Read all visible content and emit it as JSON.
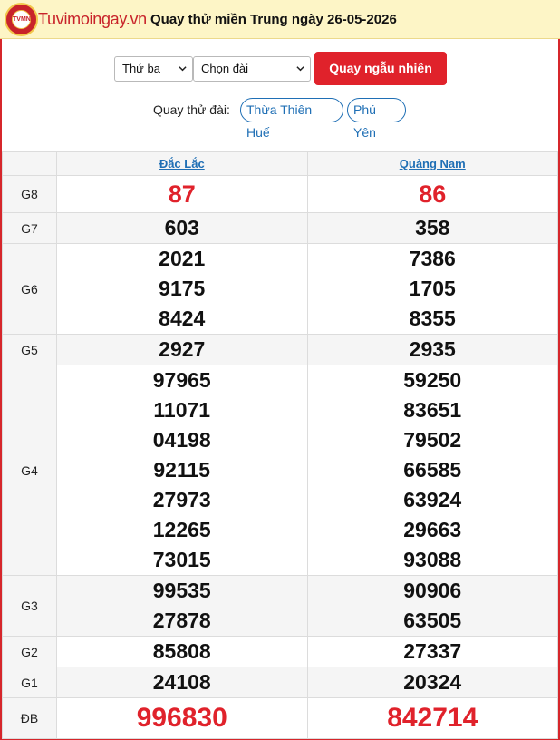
{
  "header": {
    "logo_badge": "TVMN",
    "logo_text": "Tuvimoingay.vn",
    "title": "Quay thử miền Trung ngày 26-05-2026"
  },
  "controls": {
    "day_select": "Thứ ba",
    "station_select": "Chọn đài",
    "random_button": "Quay ngẫu nhiên",
    "button_color": "#e0222b"
  },
  "stations": {
    "label": "Quay thử đài:",
    "items": [
      "Thừa Thiên Huế",
      "Phú Yên"
    ]
  },
  "table": {
    "columns": [
      "Đắc Lắc",
      "Quảng Nam"
    ],
    "rows": [
      {
        "label": "G8",
        "style": "red",
        "values": [
          [
            "87"
          ],
          [
            "86"
          ]
        ]
      },
      {
        "label": "G7",
        "style": "normal",
        "values": [
          [
            "603"
          ],
          [
            "358"
          ]
        ]
      },
      {
        "label": "G6",
        "style": "normal",
        "values": [
          [
            "2021",
            "9175",
            "8424"
          ],
          [
            "7386",
            "1705",
            "8355"
          ]
        ]
      },
      {
        "label": "G5",
        "style": "normal",
        "values": [
          [
            "2927"
          ],
          [
            "2935"
          ]
        ]
      },
      {
        "label": "G4",
        "style": "normal",
        "values": [
          [
            "97965",
            "11071",
            "04198",
            "92115",
            "27973",
            "12265",
            "73015"
          ],
          [
            "59250",
            "83651",
            "79502",
            "66585",
            "63924",
            "29663",
            "93088"
          ]
        ]
      },
      {
        "label": "G3",
        "style": "normal",
        "values": [
          [
            "99535",
            "27878"
          ],
          [
            "90906",
            "63505"
          ]
        ]
      },
      {
        "label": "G2",
        "style": "normal",
        "values": [
          [
            "85808"
          ],
          [
            "27337"
          ]
        ]
      },
      {
        "label": "G1",
        "style": "normal",
        "values": [
          [
            "24108"
          ],
          [
            "20324"
          ]
        ]
      },
      {
        "label": "ĐB",
        "style": "db",
        "values": [
          [
            "996830"
          ],
          [
            "842714"
          ]
        ]
      }
    ]
  }
}
